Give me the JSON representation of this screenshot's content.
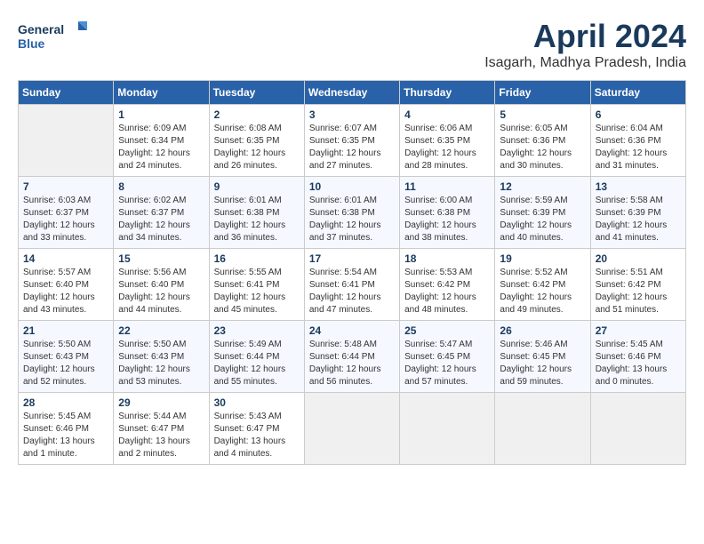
{
  "logo": {
    "text_general": "General",
    "text_blue": "Blue"
  },
  "header": {
    "month_title": "April 2024",
    "location": "Isagarh, Madhya Pradesh, India"
  },
  "weekdays": [
    "Sunday",
    "Monday",
    "Tuesday",
    "Wednesday",
    "Thursday",
    "Friday",
    "Saturday"
  ],
  "weeks": [
    [
      {
        "day": "",
        "empty": true
      },
      {
        "day": "1",
        "sunrise": "Sunrise: 6:09 AM",
        "sunset": "Sunset: 6:34 PM",
        "daylight": "Daylight: 12 hours and 24 minutes."
      },
      {
        "day": "2",
        "sunrise": "Sunrise: 6:08 AM",
        "sunset": "Sunset: 6:35 PM",
        "daylight": "Daylight: 12 hours and 26 minutes."
      },
      {
        "day": "3",
        "sunrise": "Sunrise: 6:07 AM",
        "sunset": "Sunset: 6:35 PM",
        "daylight": "Daylight: 12 hours and 27 minutes."
      },
      {
        "day": "4",
        "sunrise": "Sunrise: 6:06 AM",
        "sunset": "Sunset: 6:35 PM",
        "daylight": "Daylight: 12 hours and 28 minutes."
      },
      {
        "day": "5",
        "sunrise": "Sunrise: 6:05 AM",
        "sunset": "Sunset: 6:36 PM",
        "daylight": "Daylight: 12 hours and 30 minutes."
      },
      {
        "day": "6",
        "sunrise": "Sunrise: 6:04 AM",
        "sunset": "Sunset: 6:36 PM",
        "daylight": "Daylight: 12 hours and 31 minutes."
      }
    ],
    [
      {
        "day": "7",
        "sunrise": "Sunrise: 6:03 AM",
        "sunset": "Sunset: 6:37 PM",
        "daylight": "Daylight: 12 hours and 33 minutes."
      },
      {
        "day": "8",
        "sunrise": "Sunrise: 6:02 AM",
        "sunset": "Sunset: 6:37 PM",
        "daylight": "Daylight: 12 hours and 34 minutes."
      },
      {
        "day": "9",
        "sunrise": "Sunrise: 6:01 AM",
        "sunset": "Sunset: 6:38 PM",
        "daylight": "Daylight: 12 hours and 36 minutes."
      },
      {
        "day": "10",
        "sunrise": "Sunrise: 6:01 AM",
        "sunset": "Sunset: 6:38 PM",
        "daylight": "Daylight: 12 hours and 37 minutes."
      },
      {
        "day": "11",
        "sunrise": "Sunrise: 6:00 AM",
        "sunset": "Sunset: 6:38 PM",
        "daylight": "Daylight: 12 hours and 38 minutes."
      },
      {
        "day": "12",
        "sunrise": "Sunrise: 5:59 AM",
        "sunset": "Sunset: 6:39 PM",
        "daylight": "Daylight: 12 hours and 40 minutes."
      },
      {
        "day": "13",
        "sunrise": "Sunrise: 5:58 AM",
        "sunset": "Sunset: 6:39 PM",
        "daylight": "Daylight: 12 hours and 41 minutes."
      }
    ],
    [
      {
        "day": "14",
        "sunrise": "Sunrise: 5:57 AM",
        "sunset": "Sunset: 6:40 PM",
        "daylight": "Daylight: 12 hours and 43 minutes."
      },
      {
        "day": "15",
        "sunrise": "Sunrise: 5:56 AM",
        "sunset": "Sunset: 6:40 PM",
        "daylight": "Daylight: 12 hours and 44 minutes."
      },
      {
        "day": "16",
        "sunrise": "Sunrise: 5:55 AM",
        "sunset": "Sunset: 6:41 PM",
        "daylight": "Daylight: 12 hours and 45 minutes."
      },
      {
        "day": "17",
        "sunrise": "Sunrise: 5:54 AM",
        "sunset": "Sunset: 6:41 PM",
        "daylight": "Daylight: 12 hours and 47 minutes."
      },
      {
        "day": "18",
        "sunrise": "Sunrise: 5:53 AM",
        "sunset": "Sunset: 6:42 PM",
        "daylight": "Daylight: 12 hours and 48 minutes."
      },
      {
        "day": "19",
        "sunrise": "Sunrise: 5:52 AM",
        "sunset": "Sunset: 6:42 PM",
        "daylight": "Daylight: 12 hours and 49 minutes."
      },
      {
        "day": "20",
        "sunrise": "Sunrise: 5:51 AM",
        "sunset": "Sunset: 6:42 PM",
        "daylight": "Daylight: 12 hours and 51 minutes."
      }
    ],
    [
      {
        "day": "21",
        "sunrise": "Sunrise: 5:50 AM",
        "sunset": "Sunset: 6:43 PM",
        "daylight": "Daylight: 12 hours and 52 minutes."
      },
      {
        "day": "22",
        "sunrise": "Sunrise: 5:50 AM",
        "sunset": "Sunset: 6:43 PM",
        "daylight": "Daylight: 12 hours and 53 minutes."
      },
      {
        "day": "23",
        "sunrise": "Sunrise: 5:49 AM",
        "sunset": "Sunset: 6:44 PM",
        "daylight": "Daylight: 12 hours and 55 minutes."
      },
      {
        "day": "24",
        "sunrise": "Sunrise: 5:48 AM",
        "sunset": "Sunset: 6:44 PM",
        "daylight": "Daylight: 12 hours and 56 minutes."
      },
      {
        "day": "25",
        "sunrise": "Sunrise: 5:47 AM",
        "sunset": "Sunset: 6:45 PM",
        "daylight": "Daylight: 12 hours and 57 minutes."
      },
      {
        "day": "26",
        "sunrise": "Sunrise: 5:46 AM",
        "sunset": "Sunset: 6:45 PM",
        "daylight": "Daylight: 12 hours and 59 minutes."
      },
      {
        "day": "27",
        "sunrise": "Sunrise: 5:45 AM",
        "sunset": "Sunset: 6:46 PM",
        "daylight": "Daylight: 13 hours and 0 minutes."
      }
    ],
    [
      {
        "day": "28",
        "sunrise": "Sunrise: 5:45 AM",
        "sunset": "Sunset: 6:46 PM",
        "daylight": "Daylight: 13 hours and 1 minute."
      },
      {
        "day": "29",
        "sunrise": "Sunrise: 5:44 AM",
        "sunset": "Sunset: 6:47 PM",
        "daylight": "Daylight: 13 hours and 2 minutes."
      },
      {
        "day": "30",
        "sunrise": "Sunrise: 5:43 AM",
        "sunset": "Sunset: 6:47 PM",
        "daylight": "Daylight: 13 hours and 4 minutes."
      },
      {
        "day": "",
        "empty": true
      },
      {
        "day": "",
        "empty": true
      },
      {
        "day": "",
        "empty": true
      },
      {
        "day": "",
        "empty": true
      }
    ]
  ]
}
